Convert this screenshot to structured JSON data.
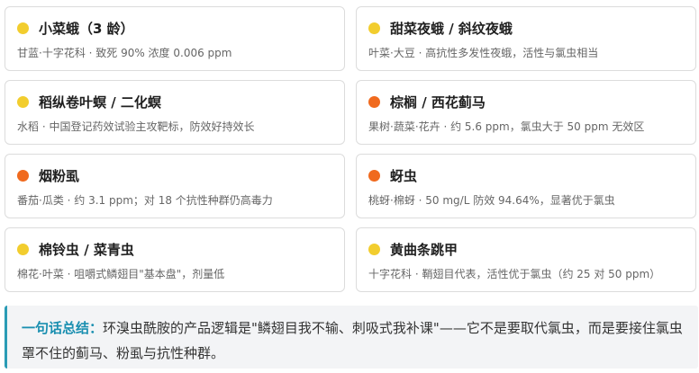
{
  "colors": {
    "yellow_dot": "#f2cd2e",
    "orange_dot": "#f06a1e",
    "accent": "#1a8fb0"
  },
  "cards": [
    {
      "title": "小菜蛾（3 龄）",
      "desc": "甘蓝·十字花科 · 致死 90% 浓度 0.006 ppm",
      "dot": "yellow"
    },
    {
      "title": "甜菜夜蛾 / 斜纹夜蛾",
      "desc": "叶菜·大豆 · 高抗性多发性夜蛾，活性与氯虫相当",
      "dot": "yellow"
    },
    {
      "title": "稻纵卷叶螟 / 二化螟",
      "desc": "水稻 · 中国登记药效试验主攻靶标，防效好持效长",
      "dot": "yellow"
    },
    {
      "title": "棕榈 / 西花蓟马",
      "desc": "果树·蔬菜·花卉 · 约 5.6 ppm，氯虫大于 50 ppm 无效区",
      "dot": "orange"
    },
    {
      "title": "烟粉虱",
      "desc": "番茄·瓜类 · 约 3.1 ppm；对 18 个抗性种群仍高毒力",
      "dot": "orange"
    },
    {
      "title": "蚜虫",
      "desc": "桃蚜·棉蚜 · 50 mg/L 防效 94.64%，显著优于氯虫",
      "dot": "orange"
    },
    {
      "title": "棉铃虫 / 菜青虫",
      "desc": "棉花·叶菜 · 咀嚼式鳞翅目\"基本盘\"，剂量低",
      "dot": "yellow"
    },
    {
      "title": "黄曲条跳甲",
      "desc": "十字花科 · 鞘翅目代表，活性优于氯虫（约 25 对 50 ppm）",
      "dot": "yellow"
    }
  ],
  "summary": {
    "label": "一句话总结：",
    "text": "环溴虫酰胺的产品逻辑是\"鳞翅目我不输、刺吸式我补课\"——它不是要取代氯虫，而是要接住氯虫罩不住的蓟马、粉虱与抗性种群。"
  }
}
